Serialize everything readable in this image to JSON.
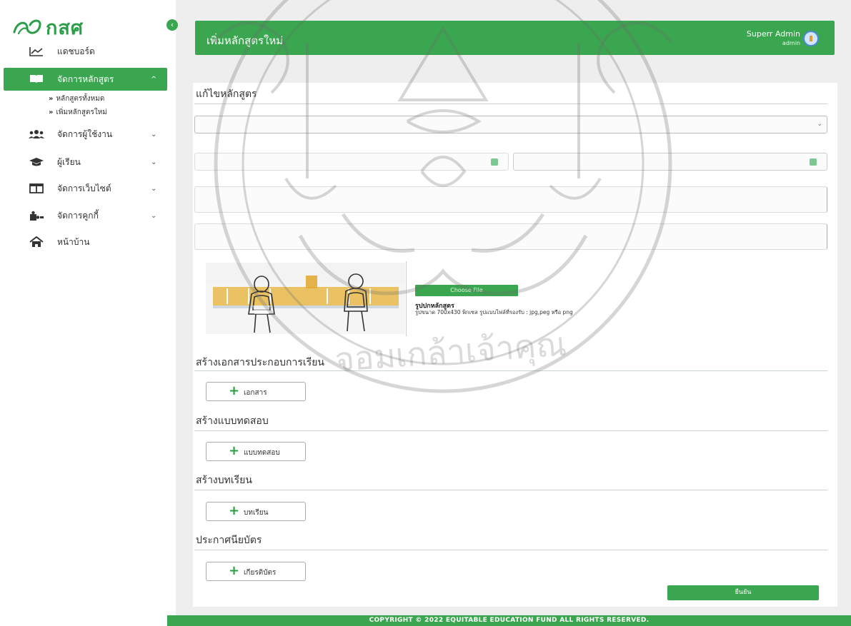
{
  "brand": {
    "logo_text": "กสศ"
  },
  "sidebar": {
    "items": [
      {
        "label": "แดชบอร์ด",
        "icon": "chart-line-icon",
        "has_chevron": false
      },
      {
        "label": "จัดการหลักสูตร",
        "icon": "book-icon",
        "has_chevron": true,
        "active": true
      },
      {
        "label": "จัดการผู้ใช้งาน",
        "icon": "users-icon",
        "has_chevron": true
      },
      {
        "label": "ผู้เรียน",
        "icon": "graduation-cap-icon",
        "has_chevron": true
      },
      {
        "label": "จัดการเว็บไซต์",
        "icon": "columns-icon",
        "has_chevron": true
      },
      {
        "label": "จัดการคูกกี้",
        "icon": "puzzle-icon",
        "has_chevron": true
      },
      {
        "label": "หน้าบ้าน",
        "icon": "home-icon",
        "has_chevron": false
      }
    ],
    "subitems": [
      {
        "label": "หลักสูตรทั้งหมด"
      },
      {
        "label": "เพิ่มหลักสูตรใหม่"
      }
    ],
    "collapse_icon": "chevron-left-icon"
  },
  "header": {
    "title": "เพิ่มหลักสูตรใหม่",
    "user_name": "Superr Admin",
    "user_role": "admin"
  },
  "form": {
    "section_title": "แก้ไขหลักสูตร",
    "cover": {
      "choose_file_label": "Choose File",
      "label": "รูปปกหลักสูตร",
      "hint": "รูปขนาด 700x430 พิกเซล รูปแบบไฟล์ที่รองรับ : jpg,peg หรือ png"
    }
  },
  "sections": [
    {
      "title": "สร้างเอกสารประกอบการเรียน",
      "button_label": "เอกสาร"
    },
    {
      "title": "สร้างแบบทดสอบ",
      "button_label": "แบบทดสอบ"
    },
    {
      "title": "สร้างบทเรียน",
      "button_label": "บทเรียน"
    },
    {
      "title": "ประกาศนียบัตร",
      "button_label": "เกียรติบัตร"
    }
  ],
  "submit_label": "ยืนยัน",
  "footer": {
    "copyright": "COPYRIGHT © 2022 EQUITABLE EDUCATION FUND ALL RIGHTS RESERVED."
  },
  "colors": {
    "accent": "#3aa64f",
    "background": "#eeeeee",
    "card": "#ffffff"
  }
}
